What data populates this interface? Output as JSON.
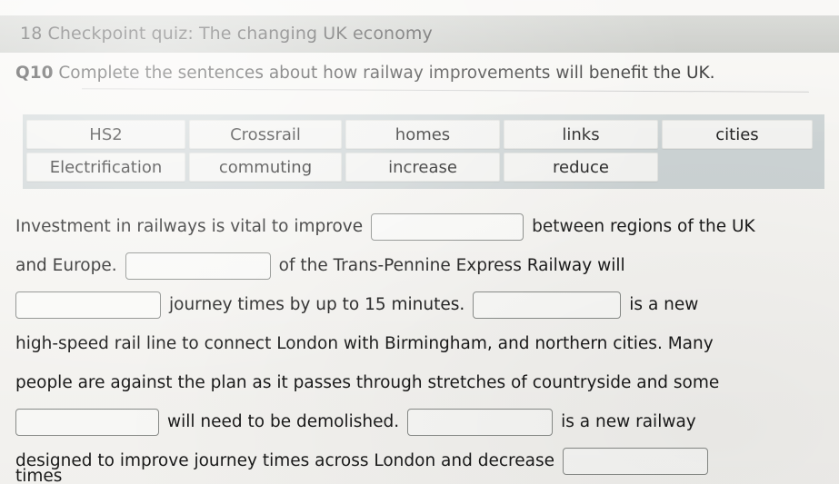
{
  "header": {
    "title": "18 Checkpoint quiz: The changing UK economy"
  },
  "question": {
    "number": "Q10",
    "instruction": "Complete the sentences about how railway improvements will benefit the UK."
  },
  "word_bank": {
    "rows": [
      [
        {
          "label": "HS2"
        },
        {
          "label": "Crossrail"
        },
        {
          "label": "homes"
        },
        {
          "label": "links"
        },
        {
          "label": "cities"
        }
      ],
      [
        {
          "label": "Electrification"
        },
        {
          "label": "commuting"
        },
        {
          "label": "increase"
        },
        {
          "label": "reduce"
        }
      ]
    ]
  },
  "sentence": {
    "line1_before": "Investment in railways is vital to improve",
    "line1_after": "between regions of the UK",
    "line2_before": "and Europe.",
    "line2_after": "of the Trans-Pennine Express Railway will",
    "line3_mid": "journey times by up to 15 minutes.",
    "line3_after": "is a new",
    "line4": "high-speed rail line to connect London with Birmingham, and northern cities. Many",
    "line5": "people are against the plan as it passes through stretches of countryside and some",
    "line6_mid": "will need to be demolished.",
    "line6_after": "is a new railway",
    "line7_before": "designed to improve journey times across London and decrease",
    "line8": "times"
  },
  "blanks": {
    "blank1_value": "",
    "blank2_value": "",
    "blank3_value": "",
    "blank4_value": "",
    "blank5_value": "",
    "blank6_value": "",
    "blank7_value": ""
  },
  "colors": {
    "page_background": "#f6f5f2",
    "header_band": "#c4c6c1",
    "word_bank_background": "#ccd3d4",
    "word_chip": "#f3f3f1",
    "blank_border": "#8a8d8a",
    "text": "#191919"
  }
}
